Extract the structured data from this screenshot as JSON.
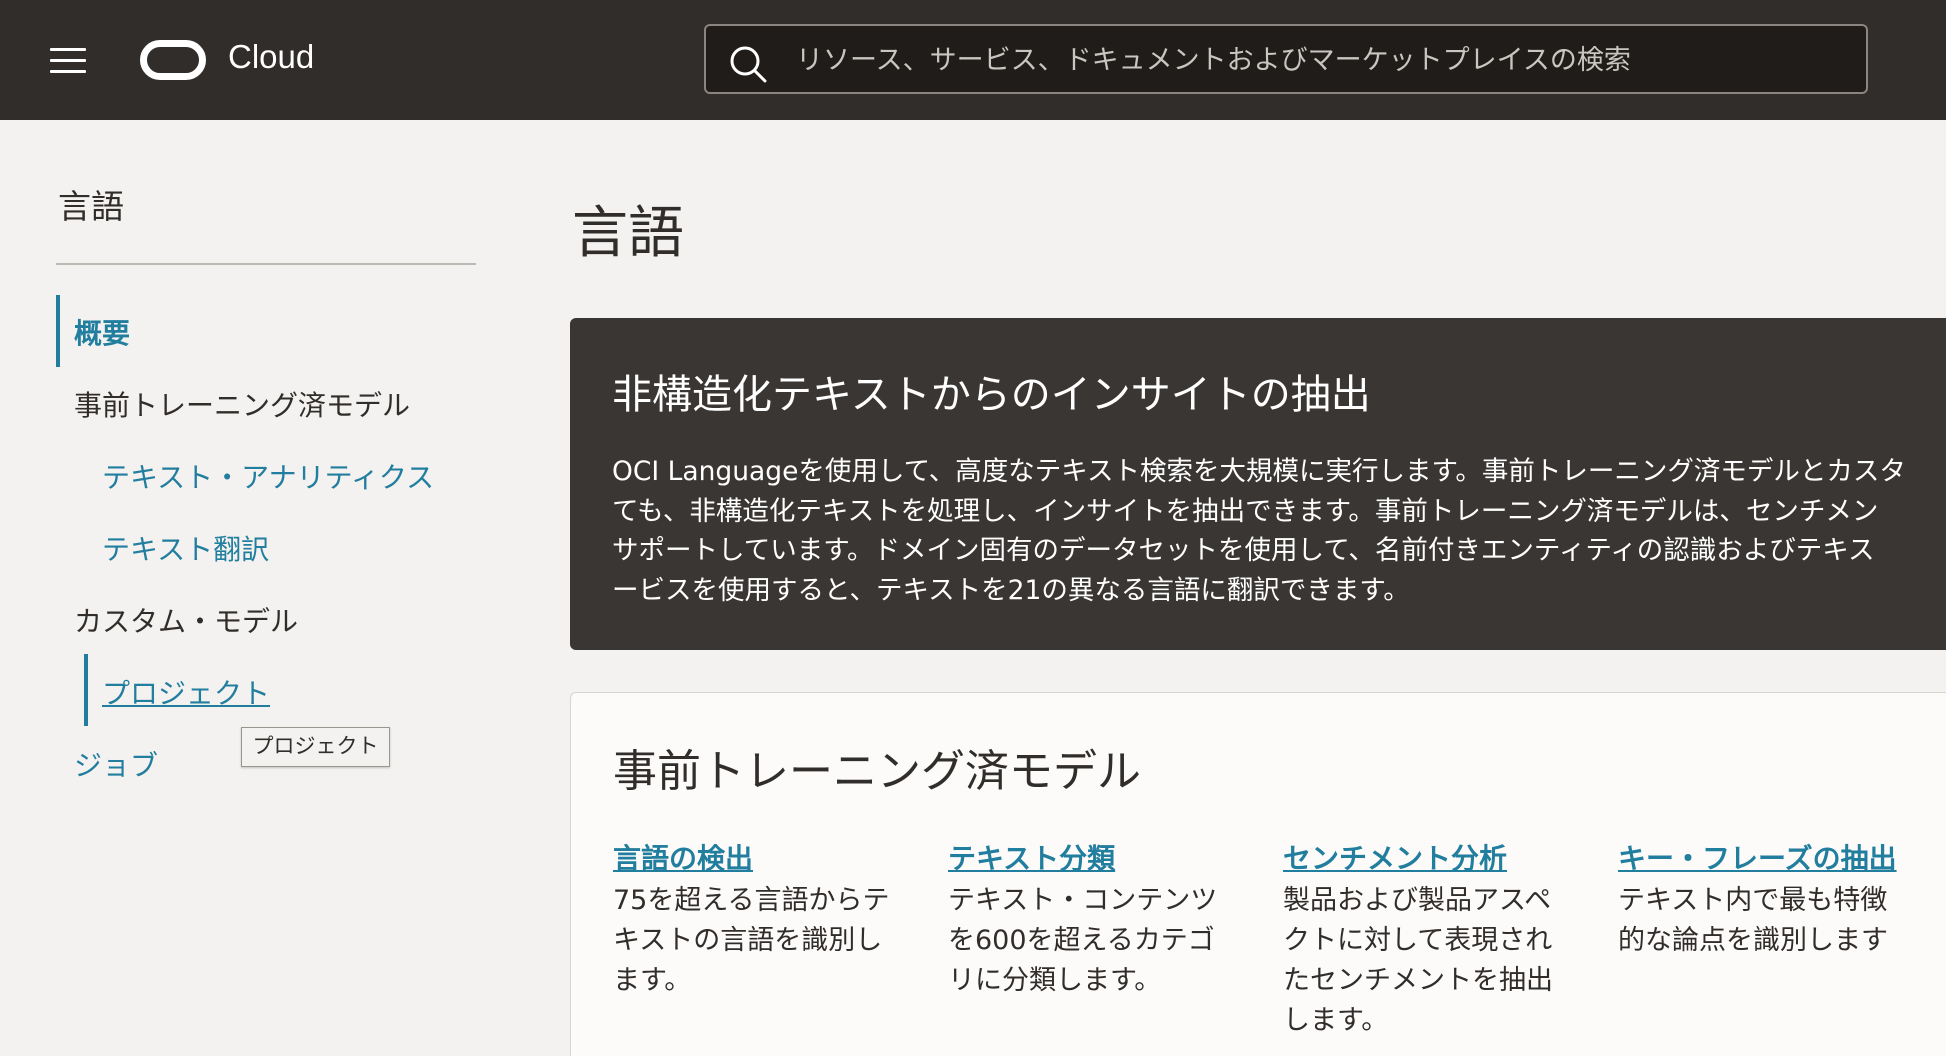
{
  "header": {
    "brand": "Cloud",
    "search_placeholder": "リソース、サービス、ドキュメントおよびマーケットプレイスの検索"
  },
  "sidebar": {
    "title": "言語",
    "items": {
      "overview": "概要",
      "pretrained": "事前トレーニング済モデル",
      "analytics": "テキスト・アナリティクス",
      "translate": "テキスト翻訳",
      "custom": "カスタム・モデル",
      "project": "プロジェクト",
      "jobs": "ジョブ"
    },
    "tooltip": "プロジェクト"
  },
  "main": {
    "title": "言語",
    "hero": {
      "title": "非構造化テキストからのインサイトの抽出",
      "lines": [
        "OCI Languageを使用して、高度なテキスト検索を大規模に実行します。事前トレーニング済モデルとカスタ",
        "ても、非構造化テキストを処理し、インサイトを抽出できます。事前トレーニング済モデルは、センチメン",
        "サポートしています。ドメイン固有のデータセットを使用して、名前付きエンティティの認識およびテキス",
        "ービスを使用すると、テキストを21の異なる言語に翻訳できます。"
      ]
    },
    "pretrained": {
      "title": "事前トレーニング済モデル",
      "models": [
        {
          "link": "言語の検出",
          "desc": [
            "75を超える言語からテ",
            "キストの言語を識別し",
            "ます。"
          ]
        },
        {
          "link": "テキスト分類",
          "desc": [
            "テキスト・コンテンツ",
            "を600を超えるカテゴ",
            "リに分類します。"
          ]
        },
        {
          "link": "センチメント分析",
          "desc": [
            "製品および製品アスペ",
            "クトに対して表現され",
            "たセンチメントを抽出",
            "します。"
          ]
        },
        {
          "link": "キー・フレーズの抽出",
          "desc": [
            "テキスト内で最も特徴",
            "的な論点を識別します"
          ]
        }
      ]
    }
  },
  "colors": {
    "header_bg": "#312d2a",
    "accent": "#227e9e",
    "hero_bg": "#3a3633"
  }
}
